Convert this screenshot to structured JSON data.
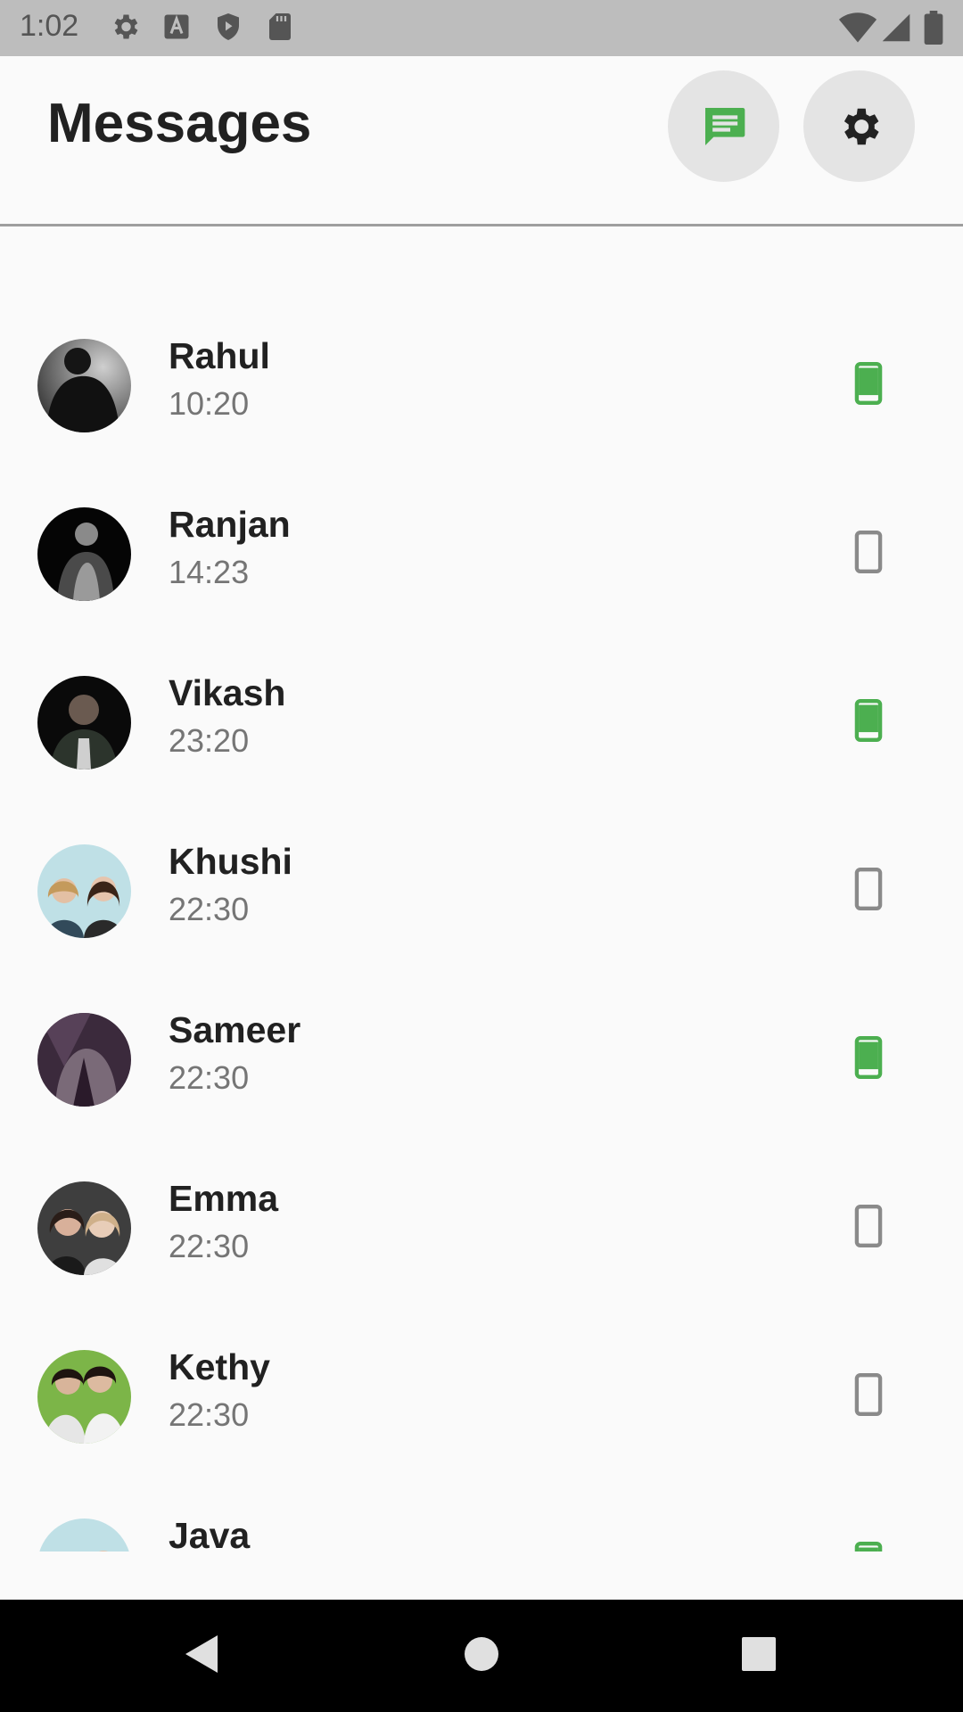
{
  "status_bar": {
    "time": "1:02",
    "icons": [
      "gear-icon",
      "font-a-icon",
      "shield-play-icon",
      "sd-card-icon"
    ],
    "right_icons": [
      "wifi-icon",
      "signal-icon",
      "battery-icon"
    ]
  },
  "header": {
    "title": "Messages",
    "buttons": [
      "chat-icon",
      "settings-gear-icon"
    ]
  },
  "colors": {
    "accent_green": "#4caf50",
    "inactive_gray": "#8a8a8a"
  },
  "contacts": [
    {
      "name": "Rahul",
      "time": "10:20",
      "device_active": true
    },
    {
      "name": "Ranjan",
      "time": "14:23",
      "device_active": false
    },
    {
      "name": "Vikash",
      "time": "23:20",
      "device_active": true
    },
    {
      "name": "Khushi",
      "time": "22:30",
      "device_active": false
    },
    {
      "name": "Sameer",
      "time": "22:30",
      "device_active": true
    },
    {
      "name": "Emma",
      "time": "22:30",
      "device_active": false
    },
    {
      "name": "Kethy",
      "time": "22:30",
      "device_active": false
    },
    {
      "name": "Java",
      "time": "",
      "device_active": true
    }
  ],
  "nav_bar": {
    "buttons": [
      "back-icon",
      "home-icon",
      "recents-icon"
    ]
  }
}
